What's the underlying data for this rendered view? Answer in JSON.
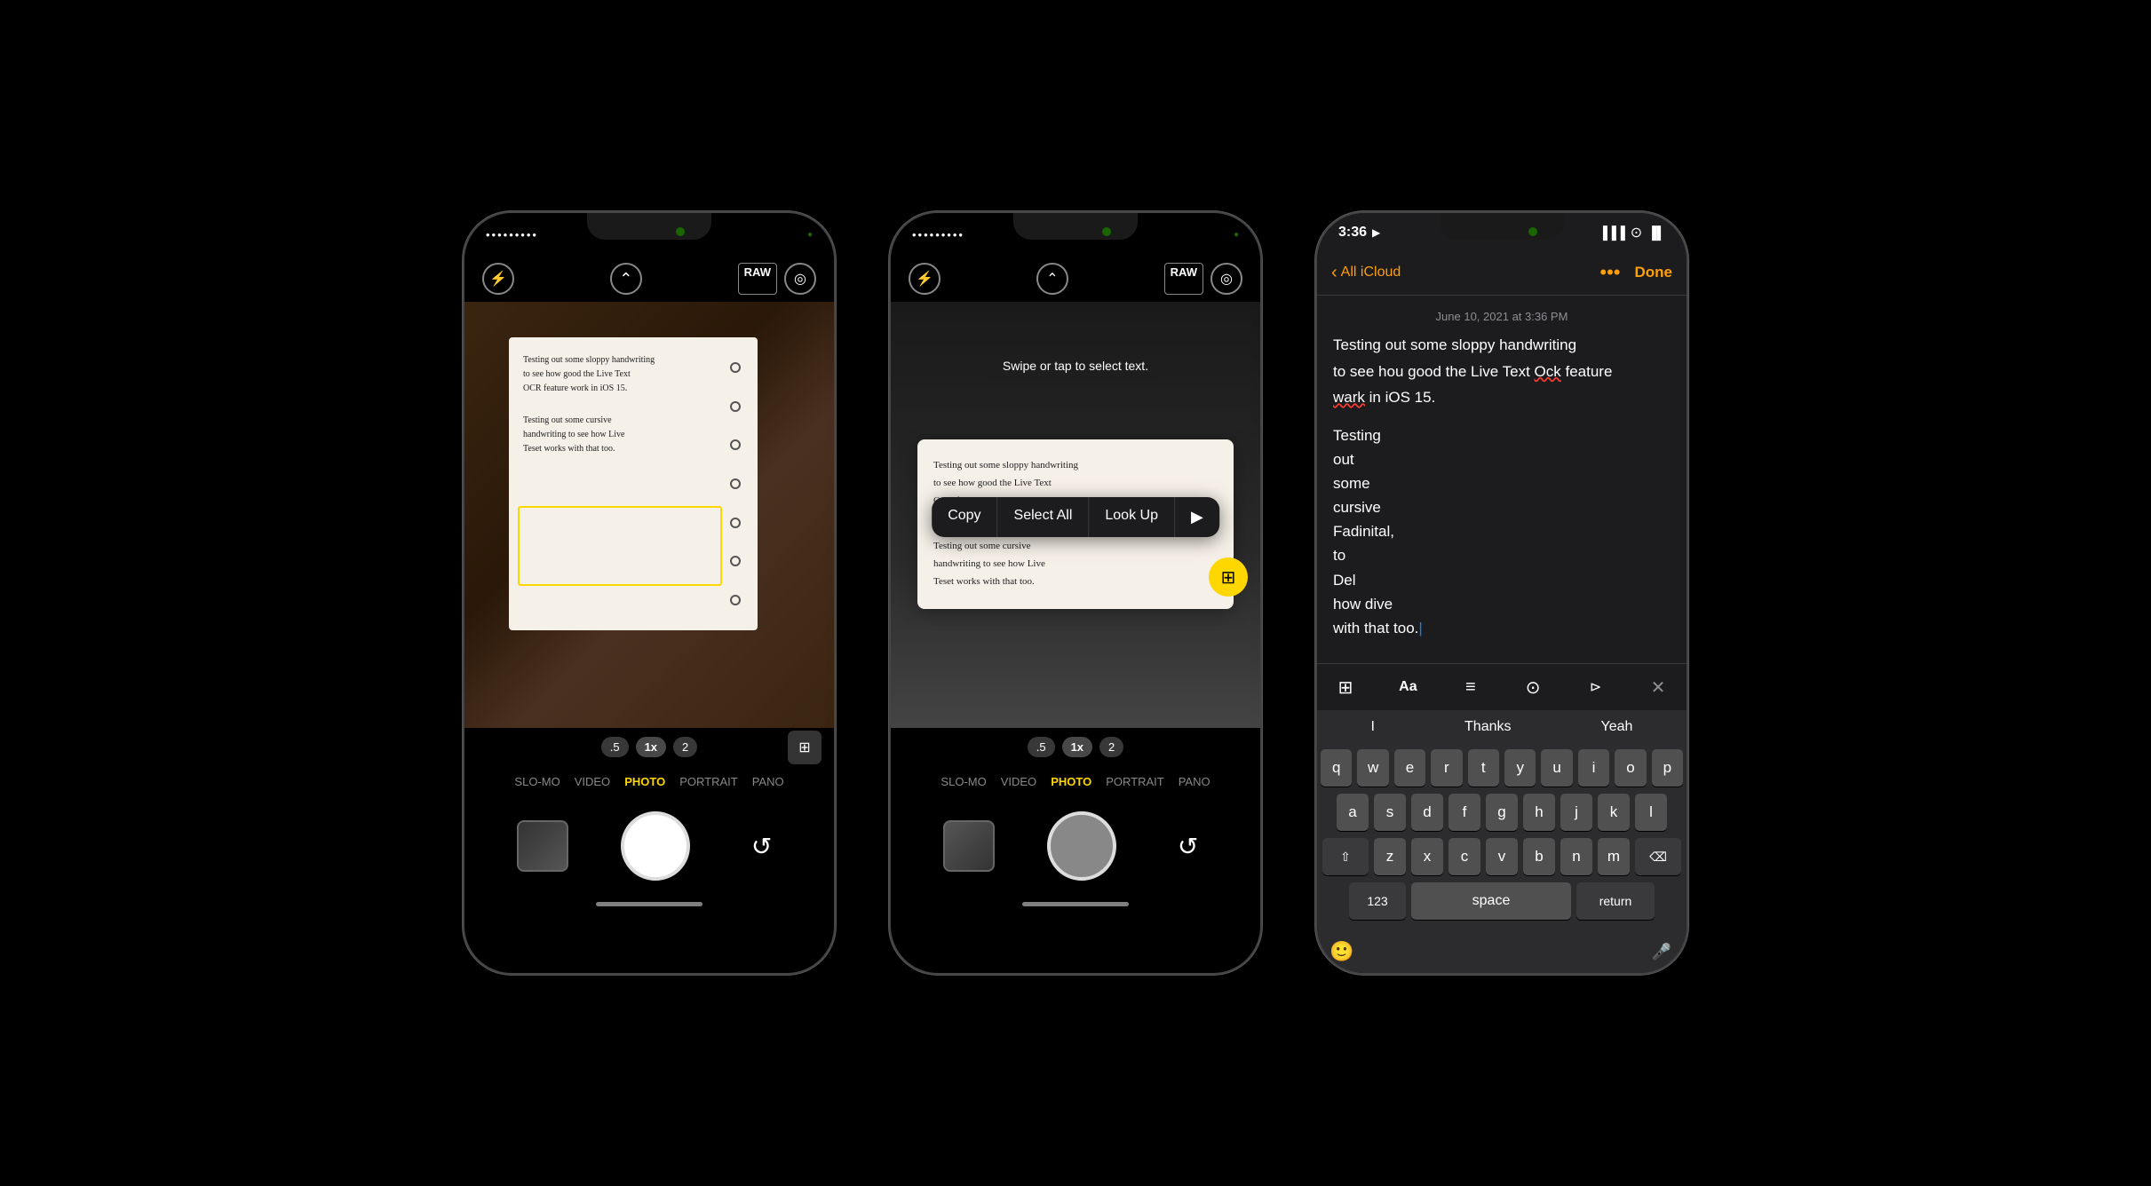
{
  "background_color": "#000000",
  "phones": [
    {
      "id": "camera-phone",
      "type": "camera",
      "status_indicator": "green",
      "top_bar": {
        "flash_label": "⚡",
        "chevron_label": "⌃",
        "raw_label": "RAW",
        "live_label": "◎"
      },
      "viewfinder": {
        "notebook_text_1": "Testing out some sloppy handwriting\nto see how good the Live Text\nOCR feature work in iOS 15.",
        "notebook_text_2": "Testing out some cursive\nhandwriting to see how Live\nTeset works with that too."
      },
      "zoom_controls": [
        {
          "label": ".5",
          "active": false
        },
        {
          "label": "1x",
          "active": true
        },
        {
          "label": "2",
          "active": false
        }
      ],
      "modes": [
        {
          "label": "SLO-MO",
          "active": false
        },
        {
          "label": "VIDEO",
          "active": false
        },
        {
          "label": "PHOTO",
          "active": true
        },
        {
          "label": "PORTRAIT",
          "active": false
        },
        {
          "label": "PANO",
          "active": false
        }
      ]
    },
    {
      "id": "ocr-phone",
      "type": "ocr",
      "tooltip": "Swipe or tap to select text.",
      "context_menu": [
        {
          "label": "Copy"
        },
        {
          "label": "Select All"
        },
        {
          "label": "Look Up"
        },
        {
          "label": "▶"
        }
      ],
      "ocr_text_1": "Testing out some sloppy handwriting\nto see how good the Live Text\nOCR feature work in iOS 15.",
      "ocr_text_2": "Testing out some cursive\nhandwriting to see how Live\nTeset works with that too.",
      "zoom_controls": [
        {
          "label": ".5",
          "active": false
        },
        {
          "label": "1x",
          "active": true
        },
        {
          "label": "2",
          "active": false
        }
      ],
      "modes": [
        {
          "label": "SLO-MO",
          "active": false
        },
        {
          "label": "VIDEO",
          "active": false
        },
        {
          "label": "PHOTO",
          "active": true
        },
        {
          "label": "PORTRAIT",
          "active": false
        },
        {
          "label": "PANO",
          "active": false
        }
      ]
    },
    {
      "id": "notes-phone",
      "type": "notes",
      "status_bar": {
        "time": "3:36",
        "location_icon": "◀",
        "signal": "▐▐▐",
        "wifi": "wifi",
        "battery": "█▌"
      },
      "nav": {
        "back_label": "All iCloud",
        "more_label": "•••",
        "done_label": "Done"
      },
      "date_label": "June 10, 2021 at 3:36 PM",
      "body_text": "Testing out some sloppy handwriting to see hou good the Live Text Ock feature wark in iOS 15.",
      "body_text_2_lines": [
        "Testing",
        "out",
        "some",
        "cursive",
        "Fadinital,",
        "to",
        "Del",
        "how dive",
        "with that too."
      ],
      "keyboard": {
        "toolbar_icons": [
          "grid",
          "Aa",
          "list",
          "camera",
          "send",
          "close"
        ],
        "quicktype": [
          "I",
          "Thanks",
          "Yeah"
        ],
        "rows": [
          [
            "q",
            "w",
            "e",
            "r",
            "t",
            "y",
            "u",
            "i",
            "o",
            "p"
          ],
          [
            "a",
            "s",
            "d",
            "f",
            "g",
            "h",
            "j",
            "k",
            "l"
          ],
          [
            "⇧",
            "z",
            "x",
            "c",
            "v",
            "b",
            "n",
            "m",
            "⌫"
          ],
          [
            "123",
            "space",
            "return"
          ]
        ],
        "bottom_extras": [
          "emoji",
          "mic"
        ]
      }
    }
  ]
}
